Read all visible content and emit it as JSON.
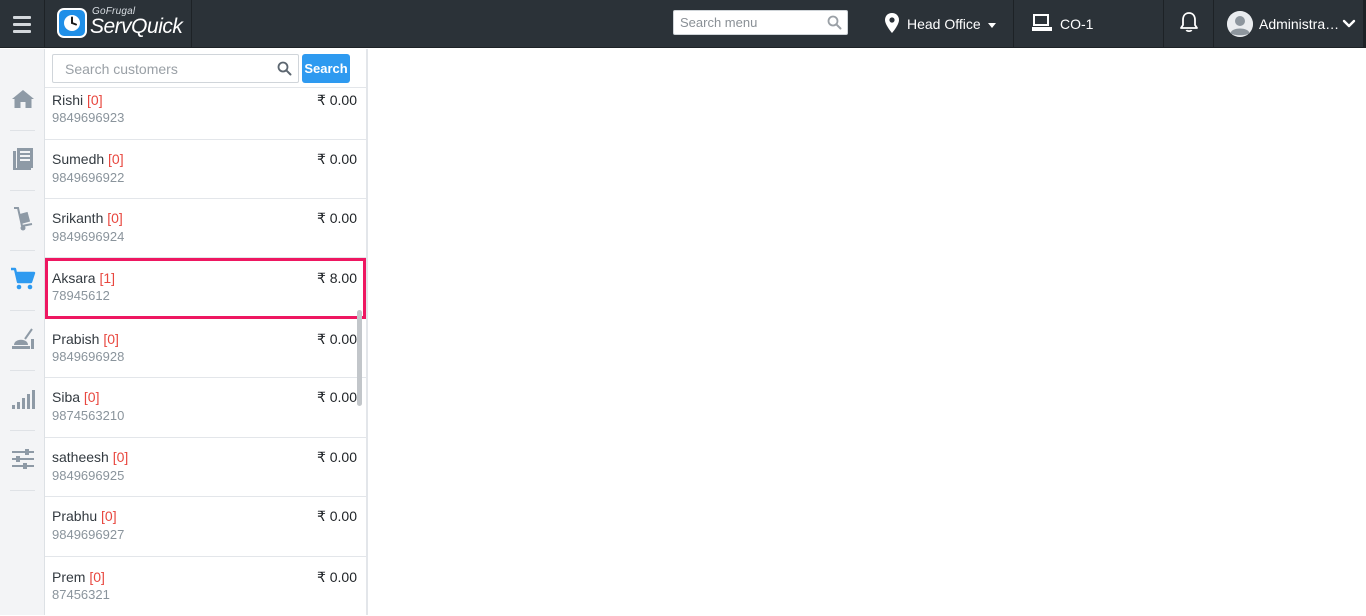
{
  "header": {
    "brand_small": "GoFrugal",
    "brand_name": "ServQuick",
    "menu_search_placeholder": "Search menu",
    "location_label": "Head Office",
    "counter_label": "CO-1",
    "user_label": "Administra…"
  },
  "sidebar": {
    "items": [
      {
        "icon": "home-icon"
      },
      {
        "icon": "catalog-icon"
      },
      {
        "icon": "inventory-icon"
      },
      {
        "icon": "cart-icon",
        "active": true
      },
      {
        "icon": "kitchen-icon"
      },
      {
        "icon": "reports-icon"
      },
      {
        "icon": "settings-icon"
      }
    ]
  },
  "customer_panel": {
    "search_placeholder": "Search customers",
    "search_button": "Search",
    "customers": [
      {
        "name": "Rishi",
        "count": "[0]",
        "phone": "9849696923",
        "amount": "₹ 0.00"
      },
      {
        "name": "Sumedh",
        "count": "[0]",
        "phone": "9849696922",
        "amount": "₹ 0.00"
      },
      {
        "name": "Srikanth",
        "count": "[0]",
        "phone": "9849696924",
        "amount": "₹ 0.00"
      },
      {
        "name": "Aksara",
        "count": "[1]",
        "phone": "78945612",
        "amount": "₹ 8.00",
        "selected": true
      },
      {
        "name": "Prabish",
        "count": "[0]",
        "phone": "9849696928",
        "amount": "₹ 0.00"
      },
      {
        "name": "Siba",
        "count": "[0]",
        "phone": "9874563210",
        "amount": "₹ 0.00"
      },
      {
        "name": "satheesh",
        "count": "[0]",
        "phone": "9849696925",
        "amount": "₹ 0.00"
      },
      {
        "name": "Prabhu",
        "count": "[0]",
        "phone": "9849696927",
        "amount": "₹ 0.00"
      },
      {
        "name": "Prem",
        "count": "[0]",
        "phone": "87456321",
        "amount": "₹ 0.00"
      }
    ]
  },
  "colors": {
    "topbar": "#2b3238",
    "accent": "#2e9af0",
    "count_red": "#e8473f",
    "selection": "#ee1761"
  }
}
